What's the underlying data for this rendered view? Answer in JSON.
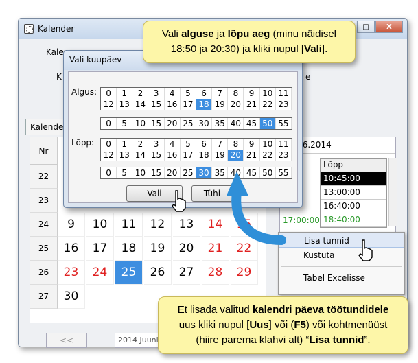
{
  "window": {
    "title": "Kalender",
    "min": "_",
    "max": "□",
    "close": "X"
  },
  "bg_labels": {
    "l1": "Kalenc",
    "l2": "K",
    "l3": "e"
  },
  "tab": "Kalender",
  "calendar": {
    "header": "Nr",
    "weeks": [
      "22",
      "23",
      "24",
      "25",
      "26",
      "27"
    ],
    "rows": [
      {
        "week": "24",
        "days": [
          "9",
          "10",
          "11",
          "12",
          "13",
          "14",
          "15"
        ]
      },
      {
        "week": "25",
        "days": [
          "16",
          "17",
          "18",
          "19",
          "20",
          "21",
          "22"
        ]
      },
      {
        "week": "26",
        "days": [
          "23",
          "24",
          "25",
          "26",
          "27",
          "28",
          "29"
        ]
      },
      {
        "week": "27",
        "days": [
          "30"
        ]
      }
    ],
    "selected": "25"
  },
  "right": {
    "date": "25.06.2014",
    "col": "Lõpp",
    "rows": [
      "10:45:00",
      "13:00:00",
      "16:40:00",
      "18:40:00"
    ],
    "extra": "17:00:00"
  },
  "nav": {
    "prev": "<<",
    "month": "2014 Juuni"
  },
  "context_menu": [
    "Lisa tunnid",
    "Kustuta",
    "Tabel Excelisse"
  ],
  "dialog": {
    "title": "Vali kuupäev",
    "start_label": "Algus:",
    "end_label": "Lõpp:",
    "hours_row1": [
      "0",
      "1",
      "2",
      "3",
      "4",
      "5",
      "6",
      "7",
      "8",
      "9",
      "10",
      "11"
    ],
    "hours_row2": [
      "12",
      "13",
      "14",
      "15",
      "16",
      "17",
      "18",
      "19",
      "20",
      "21",
      "22",
      "23"
    ],
    "minutes": [
      "0",
      "5",
      "10",
      "15",
      "20",
      "25",
      "30",
      "35",
      "40",
      "45",
      "50",
      "55"
    ],
    "start_hour": "18",
    "start_min": "50",
    "end_hour": "20",
    "end_min": "30",
    "ok": "Vali",
    "clear": "Tühi"
  },
  "callout_top": {
    "a": "Vali ",
    "b": "alguse",
    "c": " ja ",
    "d": "lõpu aeg",
    "e": " (minu näidisel",
    "f": "18:50 ja 20:30) ja kliki nupul [",
    "g": "Vali",
    "h": "]."
  },
  "callout_bottom": {
    "a": "Et lisada valitud ",
    "b": "kalendri päeva töötundidele",
    "c": "uus kliki nupul [",
    "d": "Uus",
    "e": "] või (",
    "f": "F5",
    "g": ") või kohtmenüüst",
    "h": "(hiire parema klahvi alt) “",
    "i": "Lisa tunnid",
    "j": "”."
  }
}
